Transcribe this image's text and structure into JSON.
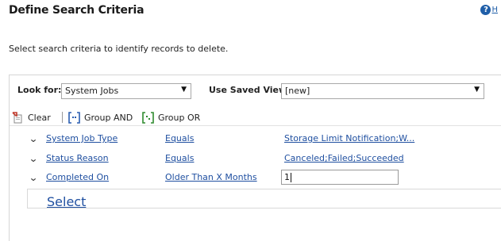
{
  "header": {
    "title": "Define Search Criteria",
    "help_icon": "help-icon",
    "help_link": "H"
  },
  "intro_text": "Select search criteria to identify records to delete.",
  "lookfor": {
    "label": "Look for:",
    "value": "System Jobs"
  },
  "saved_view": {
    "label": "Use Saved View:",
    "value": "[new]"
  },
  "toolbar": {
    "clear": "Clear",
    "group_and": "Group AND",
    "group_or": "Group OR"
  },
  "criteria": [
    {
      "field": "System Job Type",
      "operator": "Equals",
      "value": "Storage Limit Notification;W..."
    },
    {
      "field": "Status Reason",
      "operator": "Equals",
      "value": "Canceled;Failed;Succeeded"
    },
    {
      "field": "Completed On",
      "operator": "Older Than X Months",
      "value": "1"
    }
  ],
  "add_row": {
    "select_label": "Select"
  },
  "colors": {
    "link": "#1f4fa0",
    "accent": "#1f5ea8",
    "group_and_icon": "#2a5db0",
    "group_or_icon": "#2e8b2e",
    "clear_icon": "#c0392b"
  }
}
